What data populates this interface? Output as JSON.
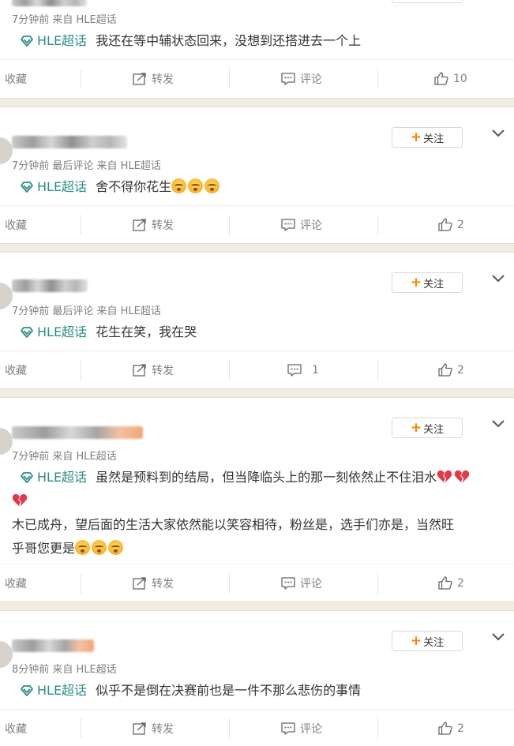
{
  "posts": [
    {
      "meta": "7分钟前 来自 HLE超话",
      "topic": "HLE超话",
      "text": "我还在等中辅状态回来，没想到还搭进去一个上",
      "actions": {
        "collect": "收藏",
        "repost": "转发",
        "comment": "评论",
        "like": "10"
      }
    },
    {
      "meta": "7分钟前 最后评论 来自 HLE超话",
      "topic": "HLE超话",
      "text": "舍不得你花生",
      "follow": "关注",
      "actions": {
        "collect": "收藏",
        "repost": "转发",
        "comment": "评论",
        "like": "2"
      }
    },
    {
      "meta": "7分钟前 最后评论 来自 HLE超话",
      "topic": "HLE超话",
      "text": "花生在笑，我在哭",
      "follow": "关注",
      "actions": {
        "collect": "收藏",
        "repost": "转发",
        "comment": "1",
        "like": "2"
      }
    },
    {
      "meta": "7分钟前 来自 HLE超话",
      "topic": "HLE超话",
      "text": "虽然是预料到的结局，但当降临头上的那一刻依然止不住泪水",
      "text2": "木已成舟，望后面的生活大家依然能以笑容相待，粉丝是，选手们亦是，当然旺",
      "text3": "乎哥您更是",
      "follow": "关注",
      "actions": {
        "collect": "收藏",
        "repost": "转发",
        "comment": "评论",
        "like": "2"
      }
    },
    {
      "meta": "8分钟前 来自 HLE超话",
      "topic": "HLE超话",
      "text": "似乎不是倒在决赛前也是一件不那么悲伤的事情",
      "follow": "关注",
      "actions": {
        "collect": "收藏",
        "repost": "转发",
        "comment": "评论",
        "like": "2"
      }
    }
  ],
  "icons": {
    "topic": "diamond-topic-icon",
    "repost": "share-box-icon",
    "comment": "comment-bubble-icon",
    "like": "thumbs-up-icon",
    "more": "chevron-down-icon",
    "emoji": "crying-face-emoji",
    "heart": "broken-heart-emoji"
  },
  "colors": {
    "topic": "#2a8d84",
    "follow_plus": "#ff8200",
    "meta": "#808080",
    "separator": "#f2ede3"
  }
}
